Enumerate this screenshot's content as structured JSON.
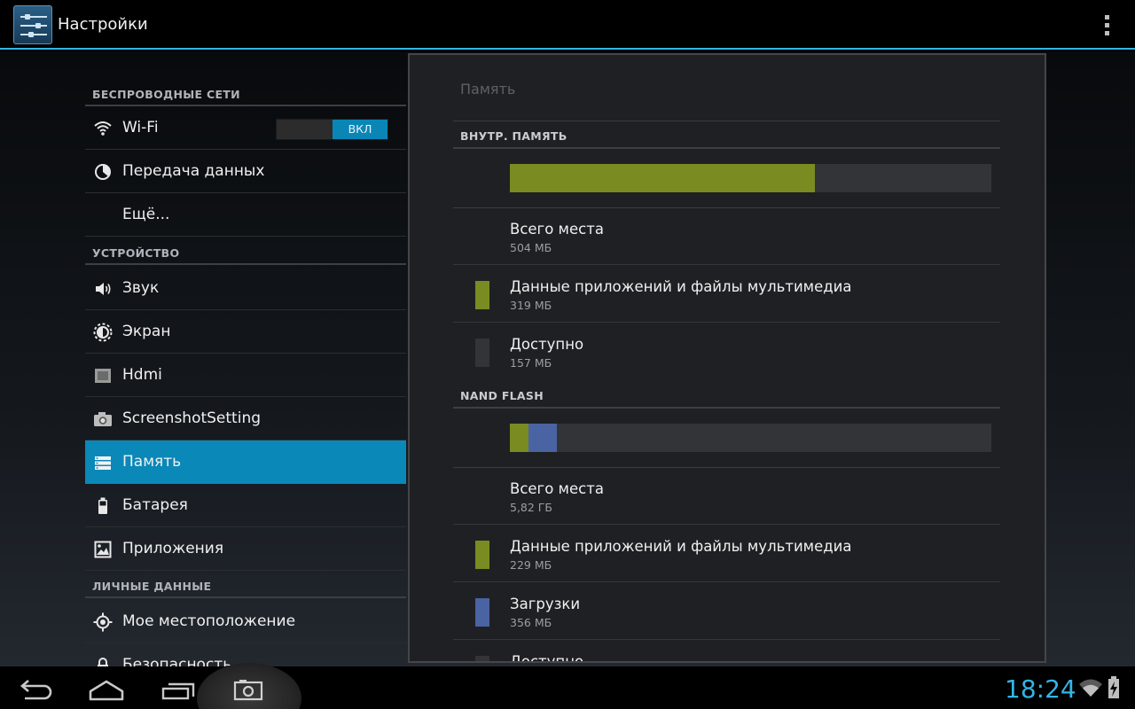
{
  "app": {
    "title": "Настройки",
    "icon": "settings-sliders-icon",
    "overflow_icon": "overflow-menu-icon"
  },
  "sidebar": {
    "categories": [
      {
        "label": "БЕСПРОВОДНЫЕ СЕТИ"
      },
      {
        "label": "УСТРОЙСТВО"
      },
      {
        "label": "ЛИЧНЫЕ ДАННЫЕ"
      }
    ],
    "items": [
      {
        "label": "Wi-Fi",
        "icon": "wifi-icon",
        "toggle": "ВКЛ"
      },
      {
        "label": "Передача данных",
        "icon": "data-usage-icon"
      },
      {
        "label": "Ещё..."
      },
      {
        "label": "Звук",
        "icon": "speaker-icon"
      },
      {
        "label": "Экран",
        "icon": "brightness-icon"
      },
      {
        "label": "Hdmi",
        "icon": "hdmi-icon"
      },
      {
        "label": "ScreenshotSetting",
        "icon": "camera-icon"
      },
      {
        "label": "Память",
        "icon": "storage-icon",
        "selected": true
      },
      {
        "label": "Батарея",
        "icon": "battery-icon"
      },
      {
        "label": "Приложения",
        "icon": "apps-icon"
      },
      {
        "label": "Мое местоположение",
        "icon": "location-icon"
      },
      {
        "label": "Безопасность",
        "icon": "lock-icon"
      }
    ]
  },
  "storage": {
    "title": "Память",
    "colors": {
      "apps": "#7a8b22",
      "downloads": "#4a63a2",
      "free": "#333437"
    },
    "internal": {
      "header": "ВНУТР. ПАМЯТЬ",
      "usage_fraction": {
        "apps": 0.633
      },
      "rows": [
        {
          "title": "Всего места",
          "value": "504 МБ"
        },
        {
          "title": "Данные приложений и файлы мультимедиа",
          "value": "319 МБ"
        },
        {
          "title": "Доступно",
          "value": "157 МБ"
        }
      ]
    },
    "nand": {
      "header": "NAND FLASH",
      "usage_fraction": {
        "apps": 0.038,
        "downloads": 0.059
      },
      "rows": [
        {
          "title": "Всего места",
          "value": "5,82 ГБ"
        },
        {
          "title": "Данные приложений и файлы мультимедиа",
          "value": "229 МБ"
        },
        {
          "title": "Загрузки",
          "value": "356 МБ"
        },
        {
          "title": "Доступно",
          "value": ""
        }
      ]
    }
  },
  "navbar": {
    "buttons": [
      "back-icon",
      "home-icon",
      "recent-apps-icon",
      "screenshot-icon"
    ],
    "clock": "18:24",
    "status_icons": [
      "wifi-signal-icon",
      "battery-charging-icon"
    ]
  }
}
